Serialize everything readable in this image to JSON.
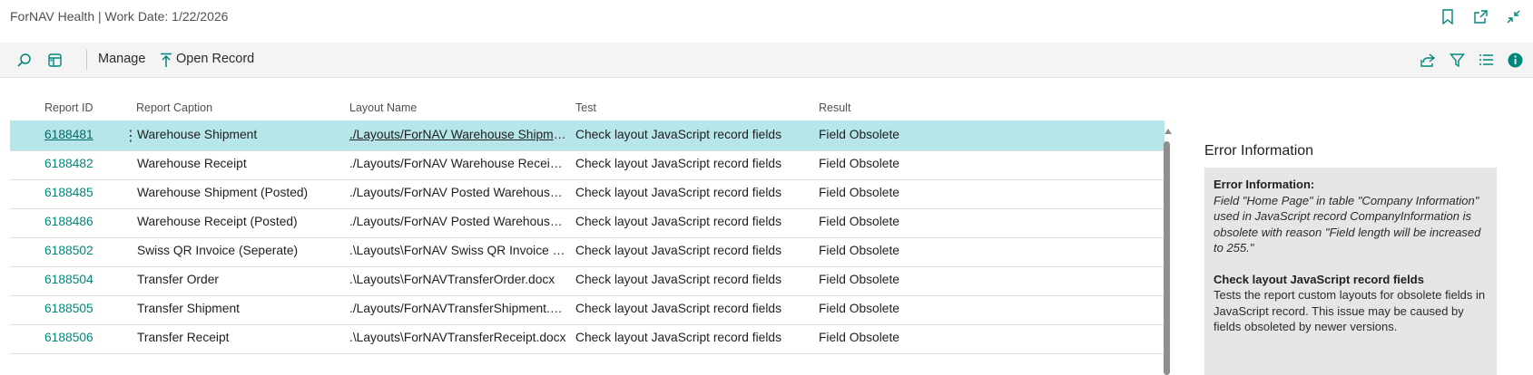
{
  "window": {
    "title": "ForNAV Health | Work Date: 1/22/2026",
    "icons": [
      "bookmark-icon",
      "open-new-window-icon",
      "collapse-icon"
    ]
  },
  "toolbar": {
    "manage_label": "Manage",
    "open_record_label": "Open Record",
    "left_icons": [
      "search-icon",
      "layout-view-icon"
    ],
    "right_icons": [
      "share-icon",
      "filter-icon",
      "list-view-icon",
      "info-icon"
    ]
  },
  "table": {
    "columns": [
      "Report ID",
      "Report Caption",
      "Layout Name",
      "Test",
      "Result"
    ],
    "rows": [
      {
        "id": "6188481",
        "caption": "Warehouse Shipment",
        "layout": "./Layouts/ForNAV Warehouse Shipment.docx",
        "test": "Check layout JavaScript record fields",
        "result": "Field Obsolete"
      },
      {
        "id": "6188482",
        "caption": "Warehouse Receipt",
        "layout": "./Layouts/ForNAV Warehouse Receipt.docx",
        "test": "Check layout JavaScript record fields",
        "result": "Field Obsolete"
      },
      {
        "id": "6188485",
        "caption": "Warehouse Shipment (Posted)",
        "layout": "./Layouts/ForNAV Posted Warehouse Shipment.docx",
        "test": "Check layout JavaScript record fields",
        "result": "Field Obsolete"
      },
      {
        "id": "6188486",
        "caption": "Warehouse Receipt (Posted)",
        "layout": "./Layouts/ForNAV Posted Warehouse Receipt.docx",
        "test": "Check layout JavaScript record fields",
        "result": "Field Obsolete"
      },
      {
        "id": "6188502",
        "caption": "Swiss QR Invoice (Seperate)",
        "layout": ".\\Layouts\\ForNAV Swiss QR Invoice Seperate.docx",
        "test": "Check layout JavaScript record fields",
        "result": "Field Obsolete"
      },
      {
        "id": "6188504",
        "caption": "Transfer Order",
        "layout": ".\\Layouts\\ForNAVTransferOrder.docx",
        "test": "Check layout JavaScript record fields",
        "result": "Field Obsolete"
      },
      {
        "id": "6188505",
        "caption": "Transfer Shipment",
        "layout": "./Layouts/ForNAVTransferShipment.docx",
        "test": "Check layout JavaScript record fields",
        "result": "Field Obsolete"
      },
      {
        "id": "6188506",
        "caption": "Transfer Receipt",
        "layout": ".\\Layouts\\ForNAVTransferReceipt.docx",
        "test": "Check layout JavaScript record fields",
        "result": "Field Obsolete"
      }
    ]
  },
  "factbox": {
    "title": "Error Information",
    "error_heading": "Error Information:",
    "error_message": "Field \"Home Page\" in table \"Company Information\" used in JavaScript record CompanyInformation is obsolete with reason \"Field length will be increased to 255.\"",
    "test_heading": "Check layout JavaScript record fields",
    "test_description": "Tests the report custom layouts for obsolete fields in JavaScript record. This issue may be caused by fields obsoleted by newer versions."
  },
  "colors": {
    "accent": "#00857a",
    "selected_row": "#b6e6ea",
    "factbox_panel": "#e6e6e6"
  }
}
